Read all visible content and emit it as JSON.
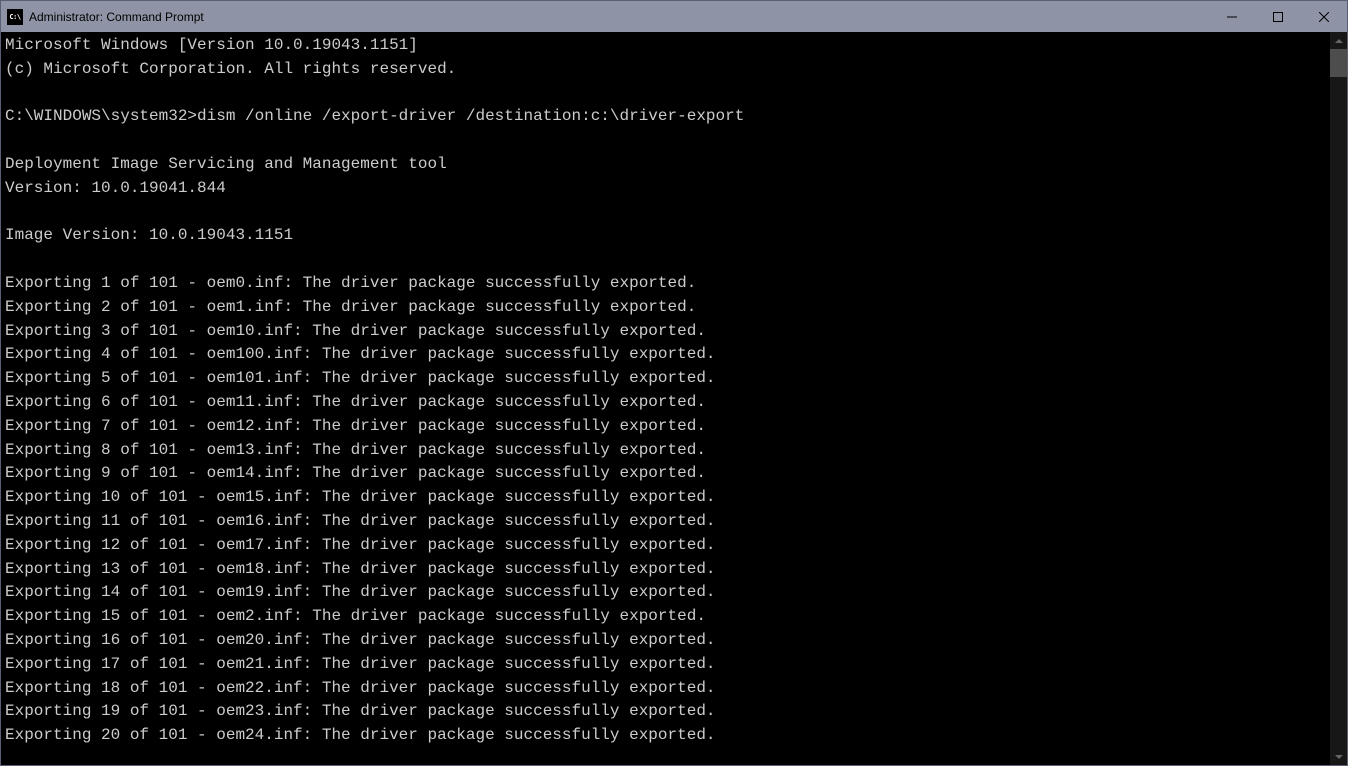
{
  "titlebar": {
    "icon_text": "C:\\",
    "title": "Administrator: Command Prompt"
  },
  "terminal": {
    "header_line1": "Microsoft Windows [Version 10.0.19043.1151]",
    "header_line2": "(c) Microsoft Corporation. All rights reserved.",
    "prompt": "C:\\WINDOWS\\system32>",
    "command": "dism /online /export-driver /destination:c:\\driver-export",
    "tool_name": "Deployment Image Servicing and Management tool",
    "tool_version": "Version: 10.0.19041.844",
    "image_version": "Image Version: 10.0.19043.1151",
    "exports": [
      "Exporting 1 of 101 - oem0.inf: The driver package successfully exported.",
      "Exporting 2 of 101 - oem1.inf: The driver package successfully exported.",
      "Exporting 3 of 101 - oem10.inf: The driver package successfully exported.",
      "Exporting 4 of 101 - oem100.inf: The driver package successfully exported.",
      "Exporting 5 of 101 - oem101.inf: The driver package successfully exported.",
      "Exporting 6 of 101 - oem11.inf: The driver package successfully exported.",
      "Exporting 7 of 101 - oem12.inf: The driver package successfully exported.",
      "Exporting 8 of 101 - oem13.inf: The driver package successfully exported.",
      "Exporting 9 of 101 - oem14.inf: The driver package successfully exported.",
      "Exporting 10 of 101 - oem15.inf: The driver package successfully exported.",
      "Exporting 11 of 101 - oem16.inf: The driver package successfully exported.",
      "Exporting 12 of 101 - oem17.inf: The driver package successfully exported.",
      "Exporting 13 of 101 - oem18.inf: The driver package successfully exported.",
      "Exporting 14 of 101 - oem19.inf: The driver package successfully exported.",
      "Exporting 15 of 101 - oem2.inf: The driver package successfully exported.",
      "Exporting 16 of 101 - oem20.inf: The driver package successfully exported.",
      "Exporting 17 of 101 - oem21.inf: The driver package successfully exported.",
      "Exporting 18 of 101 - oem22.inf: The driver package successfully exported.",
      "Exporting 19 of 101 - oem23.inf: The driver package successfully exported.",
      "Exporting 20 of 101 - oem24.inf: The driver package successfully exported."
    ]
  }
}
